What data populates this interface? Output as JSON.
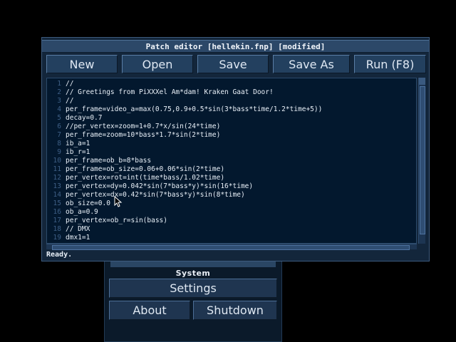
{
  "system_menu": {
    "section_label": "System",
    "settings_label": "Settings",
    "about_label": "About",
    "shutdown_label": "Shutdown"
  },
  "editor_window": {
    "title": "Patch editor [hellekin.fnp] [modified]",
    "toolbar": {
      "new_label": "New",
      "open_label": "Open",
      "save_label": "Save",
      "save_as_label": "Save As",
      "run_label": "Run (F8)"
    },
    "lines": [
      {
        "n": "1",
        "text": "//"
      },
      {
        "n": "2",
        "text": "// Greetings from PiXXXel Am*dam! Kraken Gaat Door!"
      },
      {
        "n": "3",
        "text": "//"
      },
      {
        "n": "4",
        "text": "per_frame=video_a=max(0.75,0.9+0.5*sin(3*bass*time/1.2*time+5))"
      },
      {
        "n": "5",
        "text": "decay=0.7"
      },
      {
        "n": "6",
        "text": "//per_vertex=zoom=1+0.7*x/sin(24*time)"
      },
      {
        "n": "7",
        "text": "per_frame=zoom=10*bass*1.7*sin(2*time)"
      },
      {
        "n": "8",
        "text": "ib_a=1"
      },
      {
        "n": "9",
        "text": "ib_r=1"
      },
      {
        "n": "10",
        "text": "per_frame=ob_b=8*bass"
      },
      {
        "n": "11",
        "text": "per_frame=ob_size=0.06+0.06*sin(2*time)"
      },
      {
        "n": "12",
        "text": "per_vertex=rot=int(time*bass/1.02*time)"
      },
      {
        "n": "13",
        "text": "per_vertex=dy=0.042*sin(7*bass*y)*sin(16*time)"
      },
      {
        "n": "14",
        "text": "per_vertex=dx=0.42*sin(7*bass*y)*sin(8*time)"
      },
      {
        "n": "15",
        "text": "ob_size=0.0"
      },
      {
        "n": "16",
        "text": "ob_a=0.9"
      },
      {
        "n": "17",
        "text": "per_vertex=ob_r=sin(bass)"
      },
      {
        "n": "18",
        "text": "// DMX"
      },
      {
        "n": "19",
        "text": "dmx1=1"
      }
    ],
    "status_text": "Ready."
  },
  "icons": {
    "mouse_cursor": "mouse-pointer-icon"
  },
  "colors": {
    "editor_bg": "#03182e",
    "window_bg": "#13263b",
    "text": "#e9f0f8",
    "line_numbers": "#3e5f86"
  }
}
